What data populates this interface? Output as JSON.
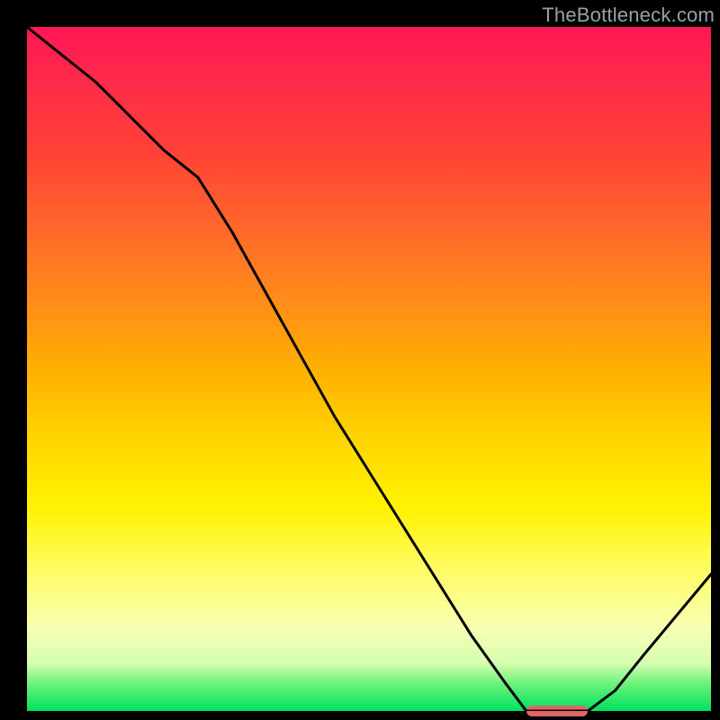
{
  "watermark": "TheBottleneck.com",
  "colors": {
    "gradient_top": "#ff1654",
    "gradient_mid1": "#ff8c1a",
    "gradient_mid2": "#fff200",
    "gradient_bottom": "#00e060",
    "curve": "#000000",
    "marker": "#e06666",
    "frame": "#000000"
  },
  "chart_data": {
    "type": "line",
    "title": "",
    "xlabel": "",
    "ylabel": "",
    "xlim": [
      0,
      100
    ],
    "ylim": [
      0,
      100
    ],
    "grid": false,
    "legend": false,
    "x": [
      0,
      5,
      10,
      15,
      20,
      25,
      30,
      35,
      40,
      45,
      50,
      55,
      60,
      65,
      70,
      73,
      78,
      82,
      86,
      90,
      95,
      100
    ],
    "values": [
      100,
      96,
      92,
      87,
      82,
      78,
      70,
      61,
      52,
      43,
      35,
      27,
      19,
      11,
      4,
      0,
      0,
      0,
      3,
      8,
      14,
      20
    ],
    "marker": {
      "x_start": 73,
      "x_end": 82,
      "y": 0
    }
  }
}
